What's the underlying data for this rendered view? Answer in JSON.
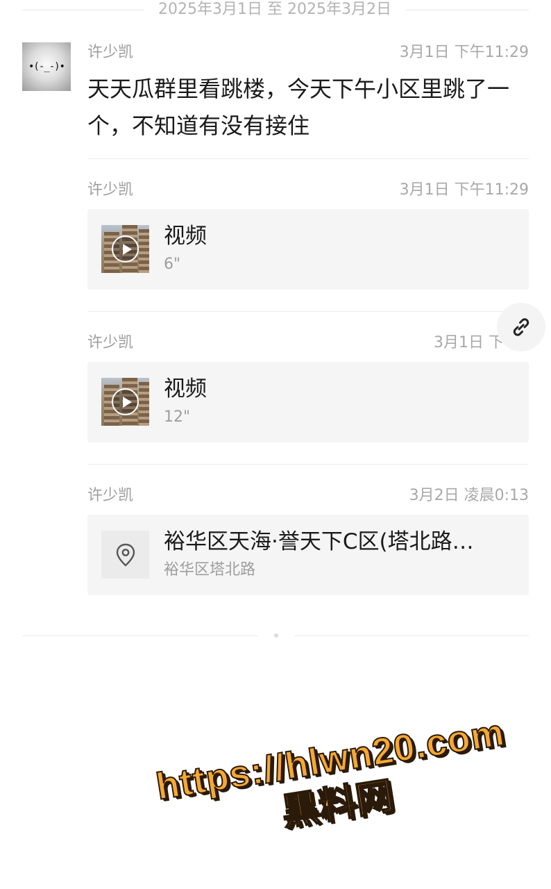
{
  "date_range": "2025年3月1日 至 2025年3月2日",
  "avatar": {
    "face_text": "•(-_-)•"
  },
  "records": [
    {
      "sender": "许少凯",
      "time": "3月1日 下午11:29",
      "text": "天天瓜群里看跳楼，今天下午小区里跳了一个，不知道有没有接住"
    },
    {
      "sender": "许少凯",
      "time": "3月1日 下午11:29",
      "type_label": "视频",
      "duration": "6\""
    },
    {
      "sender": "许少凯",
      "time": "3月1日 下午1",
      "type_label": "视频",
      "duration": "12\""
    },
    {
      "sender": "许少凯",
      "time": "3月2日 凌晨0:13",
      "location_name": "裕华区天海·誉天下C区(塔北路…",
      "location_address": "裕华区塔北路"
    }
  ],
  "icons": {
    "link": "link-icon",
    "location": "location-pin-icon",
    "play": "play-icon"
  },
  "watermark": {
    "url": "https://hlwn20.com",
    "label": "黑料网"
  },
  "colors": {
    "card_bg": "#f5f5f5",
    "meta_text": "#9e9e9e",
    "watermark_fill": "#f6a832"
  }
}
